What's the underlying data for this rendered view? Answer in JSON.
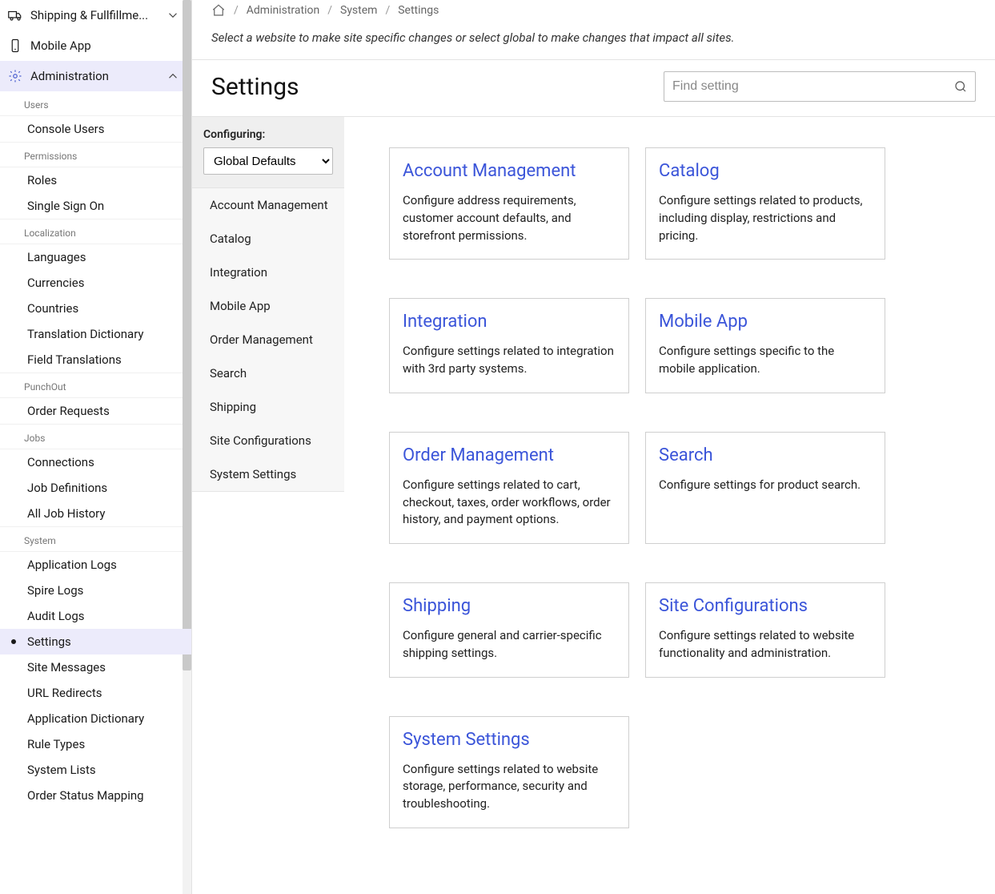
{
  "breadcrumb": {
    "home_label": "Home",
    "admin": "Administration",
    "system": "System",
    "settings": "Settings"
  },
  "page": {
    "description": "Select a website to make site specific changes or select global to make changes that impact all sites.",
    "title": "Settings"
  },
  "search": {
    "placeholder": "Find setting"
  },
  "configuring": {
    "label": "Configuring:",
    "selected": "Global Defaults"
  },
  "sec_nav": [
    "Account Management",
    "Catalog",
    "Integration",
    "Mobile App",
    "Order Management",
    "Search",
    "Shipping",
    "Site Configurations",
    "System Settings"
  ],
  "cards": [
    {
      "title": "Account Management",
      "desc": "Configure address requirements, customer account defaults, and storefront permissions."
    },
    {
      "title": "Catalog",
      "desc": "Configure settings related to products, including display, restrictions and pricing."
    },
    {
      "title": "Integration",
      "desc": "Configure settings related to integration with 3rd party systems."
    },
    {
      "title": "Mobile App",
      "desc": "Configure settings specific to the mobile application."
    },
    {
      "title": "Order Management",
      "desc": "Configure settings related to cart, checkout, taxes, order workflows, order history, and payment options."
    },
    {
      "title": "Search",
      "desc": "Configure settings for product search."
    },
    {
      "title": "Shipping",
      "desc": "Configure general and carrier-specific shipping settings."
    },
    {
      "title": "Site Configurations",
      "desc": "Configure settings related to website functionality and administration."
    },
    {
      "title": "System Settings",
      "desc": "Configure settings related to website storage, performance, security and troubleshooting."
    }
  ],
  "sidebar": {
    "top": [
      {
        "label": "Shipping & Fullfillme...",
        "icon": "truck",
        "expandable": true,
        "expanded": false
      },
      {
        "label": "Mobile App",
        "icon": "mobile",
        "expandable": false
      },
      {
        "label": "Administration",
        "icon": "gear",
        "expandable": true,
        "expanded": true,
        "active": true
      }
    ],
    "groups": [
      {
        "header": "Users",
        "items": [
          "Console Users"
        ]
      },
      {
        "header": "Permissions",
        "items": [
          "Roles",
          "Single Sign On"
        ]
      },
      {
        "header": "Localization",
        "items": [
          "Languages",
          "Currencies",
          "Countries",
          "Translation Dictionary",
          "Field Translations"
        ]
      },
      {
        "header": "PunchOut",
        "items": [
          "Order Requests"
        ]
      },
      {
        "header": "Jobs",
        "items": [
          "Connections",
          "Job Definitions",
          "All Job History"
        ]
      },
      {
        "header": "System",
        "items": [
          "Application Logs",
          "Spire Logs",
          "Audit Logs",
          "Settings",
          "Site Messages",
          "URL Redirects",
          "Application Dictionary",
          "Rule Types",
          "System Lists",
          "Order Status Mapping"
        ]
      }
    ],
    "active_sub": "Settings"
  }
}
